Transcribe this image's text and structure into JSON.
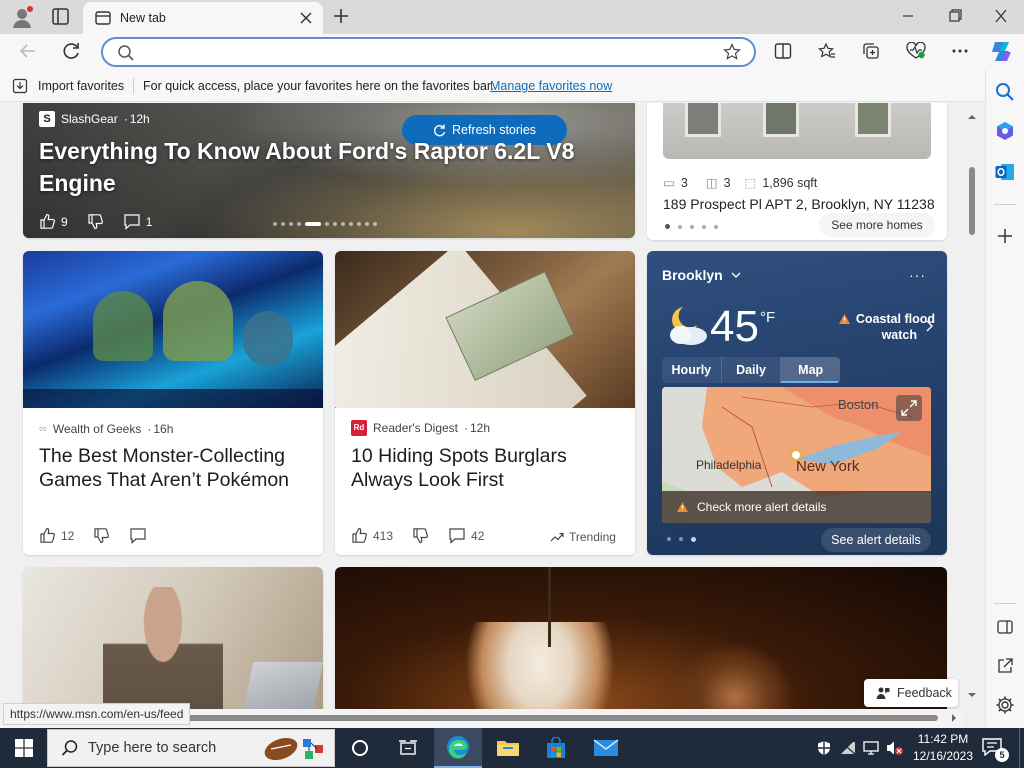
{
  "browser": {
    "tab_title": "New tab",
    "address_value": "",
    "favorites_bar": {
      "import_label": "Import favorites",
      "message": "For quick access, place your favorites here on the favorites bar.",
      "manage_link": "Manage favorites now"
    },
    "status_url": "https://www.msn.com/en-us/feed"
  },
  "feed": {
    "hero": {
      "source": "SlashGear",
      "age": "12h",
      "title_line1": "Everything To Know About Ford's Raptor 6.2L V8",
      "title_line2": "Engine",
      "likes": "9",
      "comments": "1",
      "refresh_label": "Refresh stories",
      "carousel_dots": 12,
      "active_dot": 4
    },
    "home": {
      "beds": "3",
      "baths": "3",
      "sqft": "1,896 sqft",
      "address": "189 Prospect Pl APT 2, Brooklyn, NY 11238",
      "see_more": "See more homes"
    },
    "weather": {
      "city": "Brooklyn",
      "temp": "45",
      "unit": "°F",
      "alert_line1": "Coastal flood",
      "alert_line2": "watch",
      "tabs": [
        "Hourly",
        "Daily",
        "Map"
      ],
      "active_tab": "Map",
      "map_labels": {
        "boston": "Boston",
        "philadelphia": "Philadelphia",
        "new_york": "New York"
      },
      "map_alert": "Check more alert details",
      "see_alert": "See alert details"
    },
    "card1": {
      "source": "Wealth of Geeks",
      "age": "16h",
      "title_line1": "The Best Monster-Collecting",
      "title_line2": "Games That Aren’t Pokémon",
      "likes": "12"
    },
    "card2": {
      "source": "Reader's Digest",
      "source_icon": "Rd",
      "age": "12h",
      "title_line1": "10 Hiding Spots Burglars",
      "title_line2": "Always Look First",
      "likes": "413",
      "comments": "42",
      "trending": "Trending"
    },
    "feedback_label": "Feedback"
  },
  "taskbar": {
    "search_placeholder": "Type here to search",
    "time": "11:42 PM",
    "date": "12/16/2023",
    "notification_count": "5"
  },
  "colors": {
    "accent": "#0f6cbd",
    "taskbar": "#1f2a3a",
    "weather_bg": "#2c4a78"
  }
}
